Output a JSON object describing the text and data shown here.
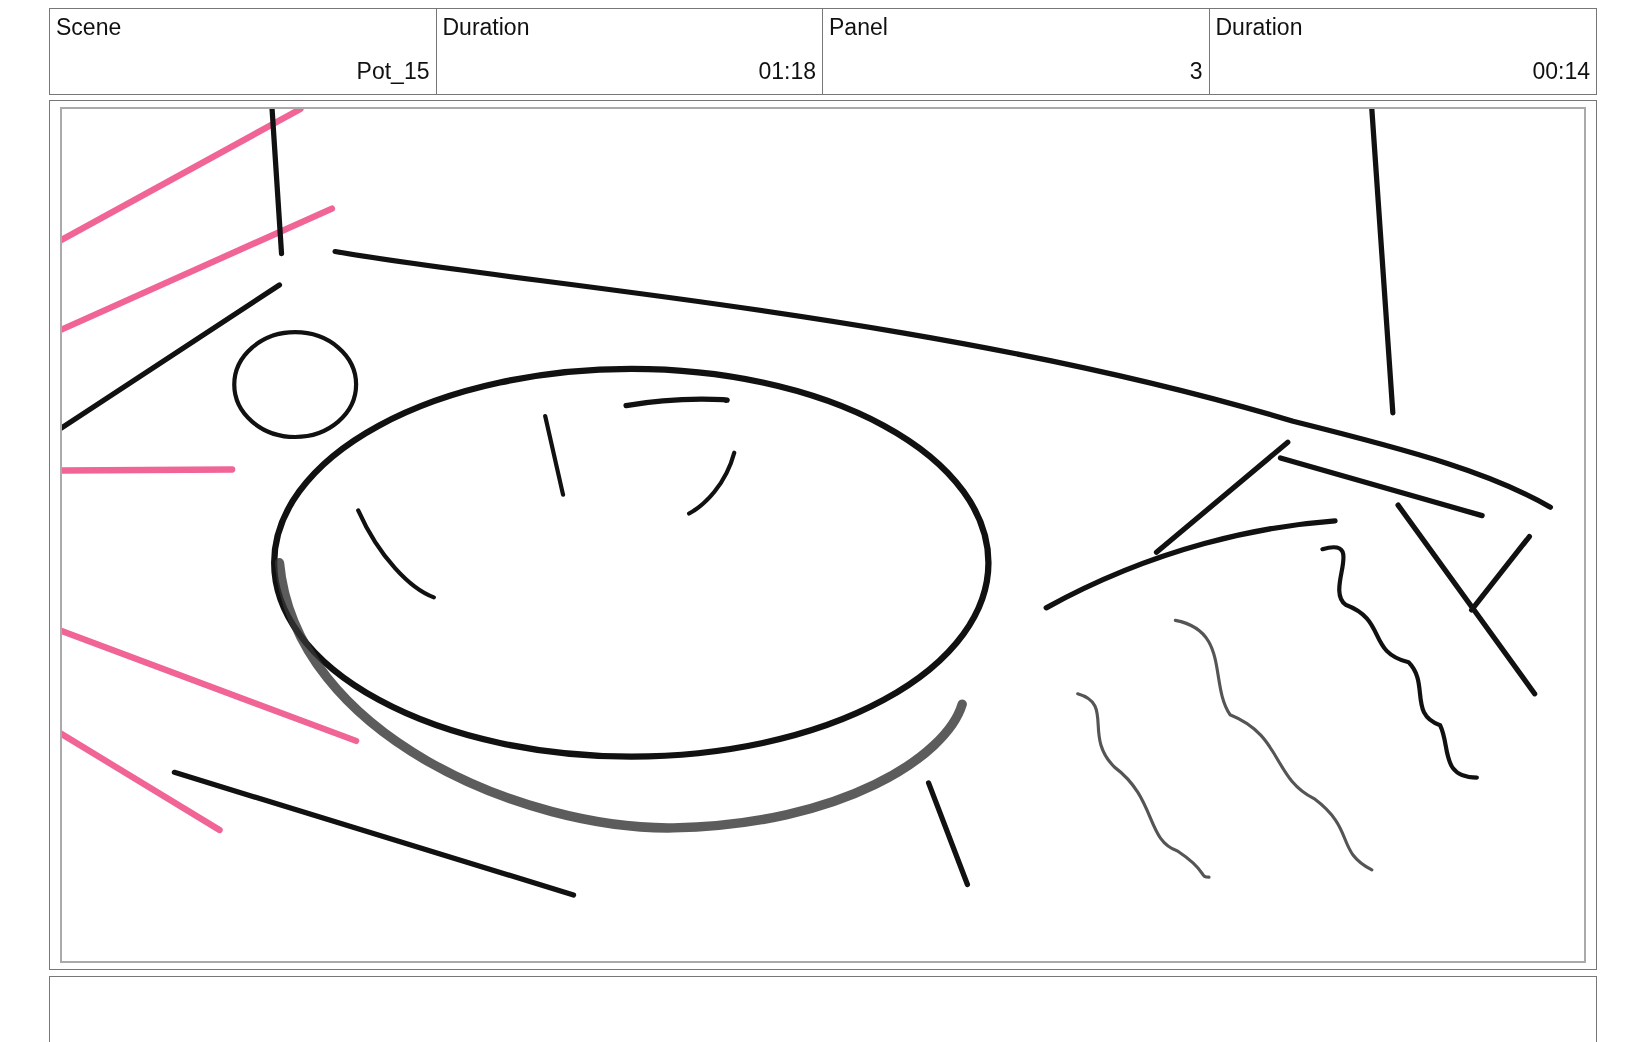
{
  "header_labels": [
    "Scene",
    "Duration",
    "Panel",
    "Duration"
  ],
  "header_values": [
    "Pot_15",
    "01:18",
    "3",
    "00:14"
  ],
  "panel": {
    "kind": "sketch"
  }
}
